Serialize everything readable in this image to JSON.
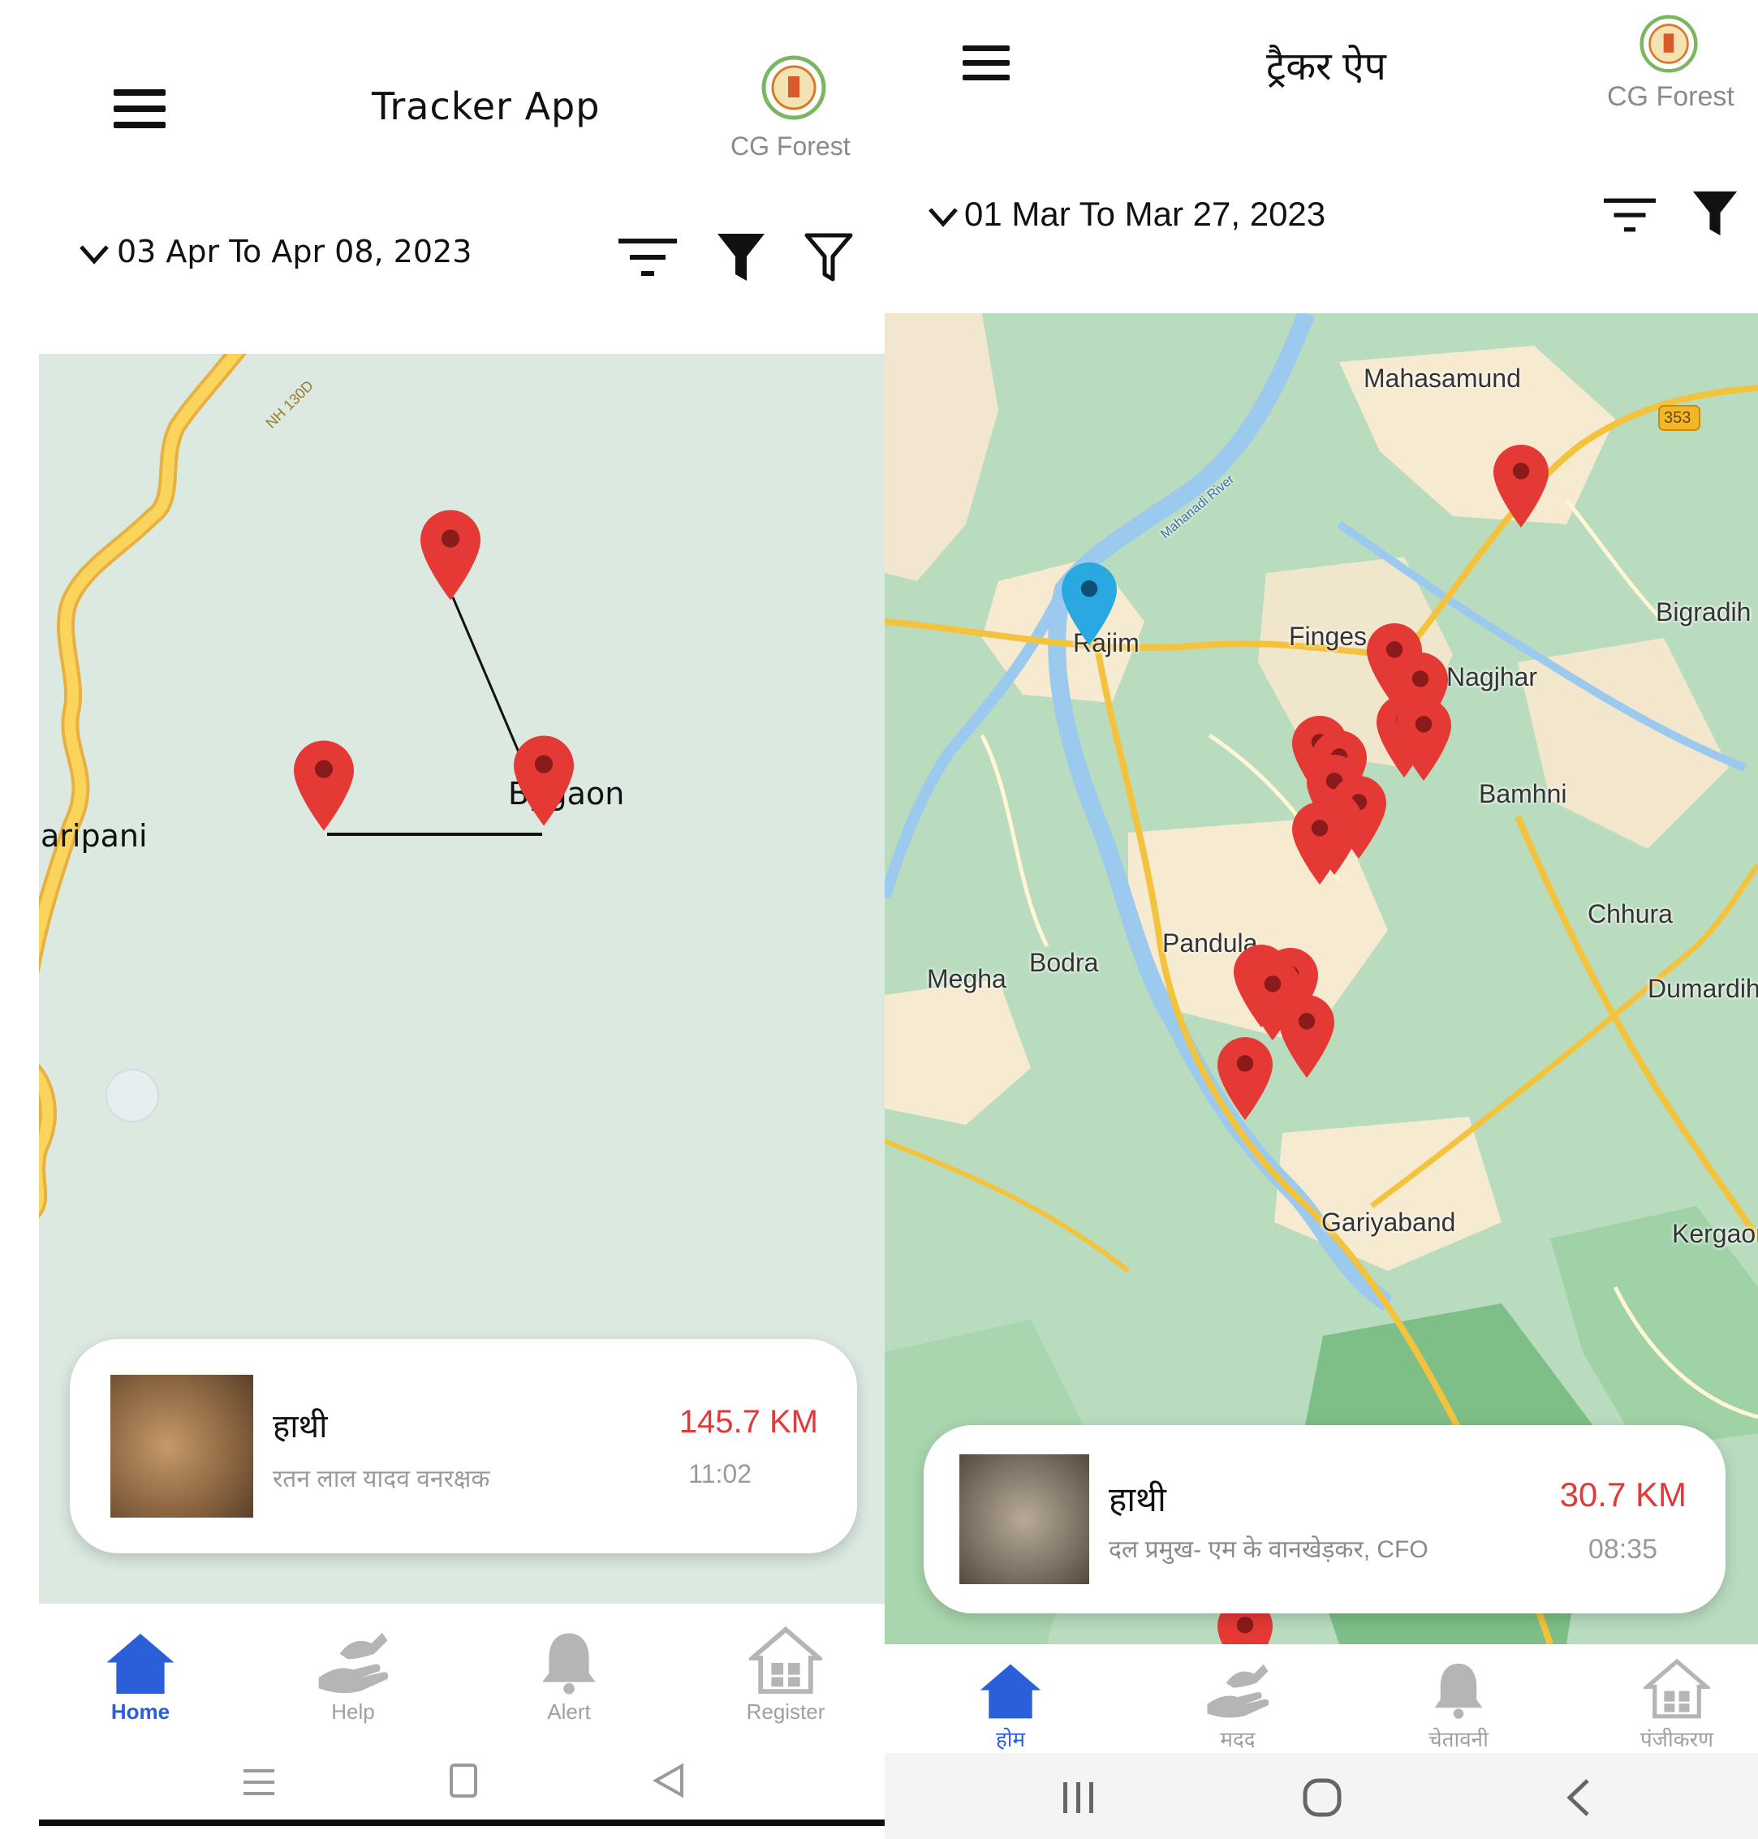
{
  "colors": {
    "accent_blue": "#2b5fd9",
    "marker_red": "#e53935",
    "marker_blue": "#2aa8e0",
    "distance_red": "#e23a3a",
    "map_left_bg": "#dbe9e1",
    "map_right_bg": "#b9dcbf",
    "road_yellow": "#f4c33e"
  },
  "left": {
    "header": {
      "menu_icon": "hamburger-menu-icon",
      "title": "Tracker App",
      "logo_label": "CG Forest"
    },
    "date_range": "03 Apr To Apr 08, 2023",
    "toolbar_icons": [
      "sort-icon",
      "filter-solid-icon",
      "filter-outline-icon"
    ],
    "map": {
      "labels": {
        "village_1": "Bygaon",
        "village_2": "aripani",
        "road": "NH 130D"
      }
    },
    "card": {
      "animal": "हाथी",
      "person": "रतन लाल यादव वनरक्षक",
      "distance": "145.7 KM",
      "time": "11:02"
    },
    "nav": [
      {
        "label": "Home",
        "icon": "home-icon",
        "active": true
      },
      {
        "label": "Help",
        "icon": "help-hands-icon",
        "active": false
      },
      {
        "label": "Alert",
        "icon": "bell-icon",
        "active": false
      },
      {
        "label": "Register",
        "icon": "register-house-icon",
        "active": false
      }
    ],
    "system_nav": [
      "recents-icon",
      "home-square-icon",
      "back-icon"
    ]
  },
  "right": {
    "header": {
      "menu_icon": "hamburger-menu-icon",
      "title": "ट्रैकर ऐप",
      "logo_label": "CG Forest"
    },
    "date_range": "01 Mar To Mar 27, 2023",
    "toolbar_icons": [
      "sort-icon",
      "filter-solid-icon"
    ],
    "map": {
      "labels": {
        "mahasamund": "Mahasamund",
        "highway": "353",
        "rajim": "Rajim",
        "finges": "Finges",
        "nagjhar": "Nagjhar",
        "bigradih": "Bigradih",
        "bamhni": "Bamhni",
        "chhura": "Chhura",
        "dumardih": "Dumardih",
        "bodra": "Bodra",
        "megha": "Megha",
        "pandu": "Pandula",
        "gariyaband": "Gariyaband",
        "kergaon": "Kergaon",
        "river": "Mahanadi River"
      }
    },
    "card": {
      "animal": "हाथी",
      "person": "दल प्रमुख- एम के वानखेड़कर, CFO",
      "distance": "30.7 KM",
      "time": "08:35"
    },
    "nav": [
      {
        "label": "होम",
        "icon": "home-icon",
        "active": true
      },
      {
        "label": "मदद",
        "icon": "help-hands-icon",
        "active": false
      },
      {
        "label": "चेतावनी",
        "icon": "bell-icon",
        "active": false
      },
      {
        "label": "पंजीकरण",
        "icon": "register-house-icon",
        "active": false
      }
    ],
    "system_nav": [
      "recents-icon",
      "home-circle-icon",
      "back-icon"
    ]
  }
}
